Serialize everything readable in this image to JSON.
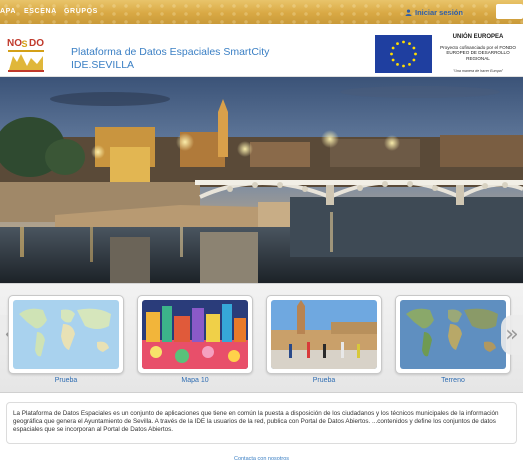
{
  "nav": {
    "items": [
      "APA",
      "ESCENA",
      "GRUPOS"
    ],
    "login_label": "Iniciar sesión"
  },
  "header": {
    "logo_text": "NOSDO",
    "title_line1": "Plataforma de Datos Espaciales SmartCity",
    "title_line2": "IDE.SEVILLA",
    "eu_title": "UNIÓN EUROPEA",
    "eu_text": "Proyecto cofinanciado por el FONDO EUROPEO DE DESARROLLO REGIONAL",
    "eu_motto": "\"Una manera de hacer Europa\""
  },
  "carousel": {
    "prev_symbol": "«",
    "next_symbol": "»",
    "cards": [
      {
        "label": "Prueba",
        "thumb": "world-map"
      },
      {
        "label": "Mapa 10",
        "thumb": "colorful-illustration"
      },
      {
        "label": "Prueba",
        "thumb": "plaza-runners-photo"
      },
      {
        "label": "Terreno",
        "thumb": "terrain-world-map"
      }
    ]
  },
  "description": "La Plataforma de Datos Espaciales es un conjunto de aplicaciones que tiene en común la puesta a disposición de los ciudadanos y los técnicos municipales de la información geográfica que genera el Ayuntamiento de Sevilla. A través de la IDE la usuarios de la red, publica con Portal de Datos Abiertos. ...contenidos y define los conjuntos de datos espaciales que se incorporan al Portal de Datos Abiertos.",
  "footer": {
    "contact_label": "Contacta con nosotros"
  },
  "colors": {
    "nav_gold": "#d9a944",
    "title_blue": "#3a7fc4",
    "link_blue": "#2f6db2",
    "eu_blue": "#1f3fa0",
    "eu_star": "#ffdd00"
  }
}
